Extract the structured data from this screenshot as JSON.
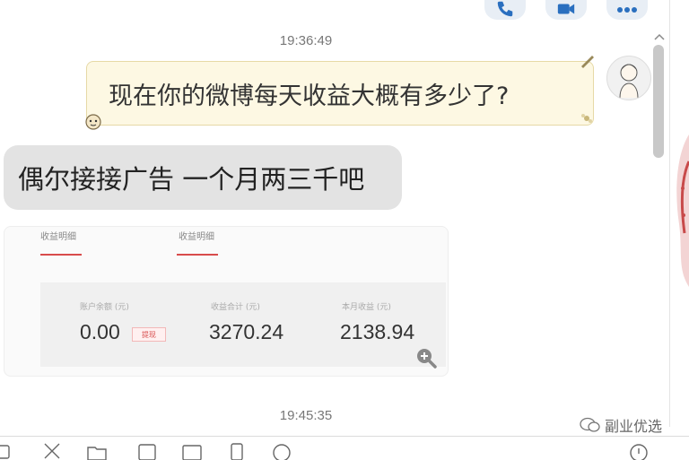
{
  "header": {
    "call_button_icon": "phone-icon",
    "video_button_icon": "video-camera-icon",
    "more_button_icon": "more-dots-icon"
  },
  "messages": [
    {
      "timestamp": "19:36:49"
    },
    {
      "direction": "outgoing",
      "text": "现在你的微博每天收益大概有多少了?"
    },
    {
      "direction": "incoming",
      "text": "偶尔接接广告 一个月两三千吧"
    },
    {
      "direction": "incoming",
      "type": "image",
      "screenshot": {
        "tabs": [
          "收益明细",
          "收益明细"
        ],
        "stats": [
          {
            "label": "账户余额 (元)",
            "value": "0.00",
            "button": "提现"
          },
          {
            "label": "收益合计 (元)",
            "value": "3270.24"
          },
          {
            "label": "本月收益 (元)",
            "value": "2138.94"
          }
        ]
      }
    },
    {
      "timestamp": "19:45:35"
    }
  ],
  "watermark": {
    "text": "副业优选"
  },
  "colors": {
    "accent": "#d84b4b",
    "outgoing_bubble": "#fdf8e3",
    "incoming_bubble": "#e3e3e3"
  }
}
